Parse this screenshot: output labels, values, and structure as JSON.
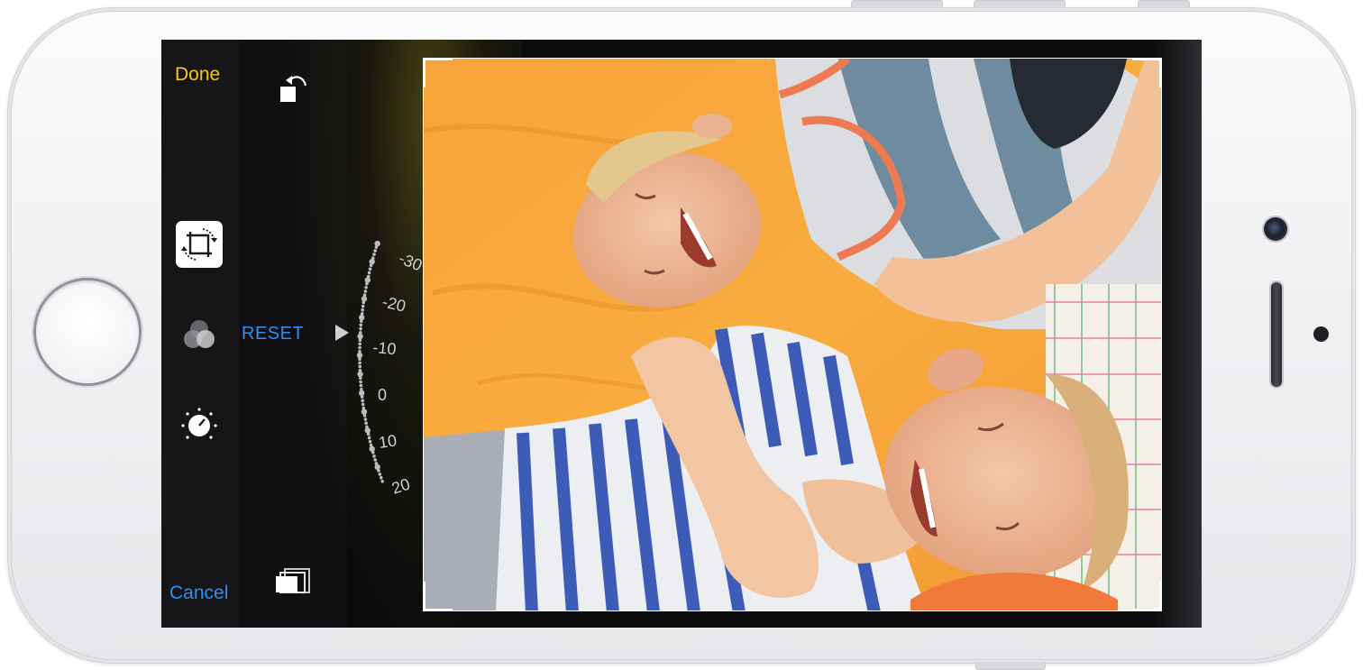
{
  "toolbar": {
    "done_label": "Done",
    "cancel_label": "Cancel",
    "reset_label": "RESET"
  },
  "icons": {
    "rotate": "rotate-icon",
    "crop": "crop-rotate-icon",
    "filters": "filters-icon",
    "adjust": "adjust-dial-icon",
    "aspect": "aspect-ratio-icon"
  },
  "dial": {
    "ticks": [
      "-30",
      "-20",
      "-10",
      "0",
      "10",
      "20"
    ]
  },
  "colors": {
    "done": "#f6c915",
    "accent_blue": "#2b8ef4",
    "toolbar_bg": "#161618"
  }
}
